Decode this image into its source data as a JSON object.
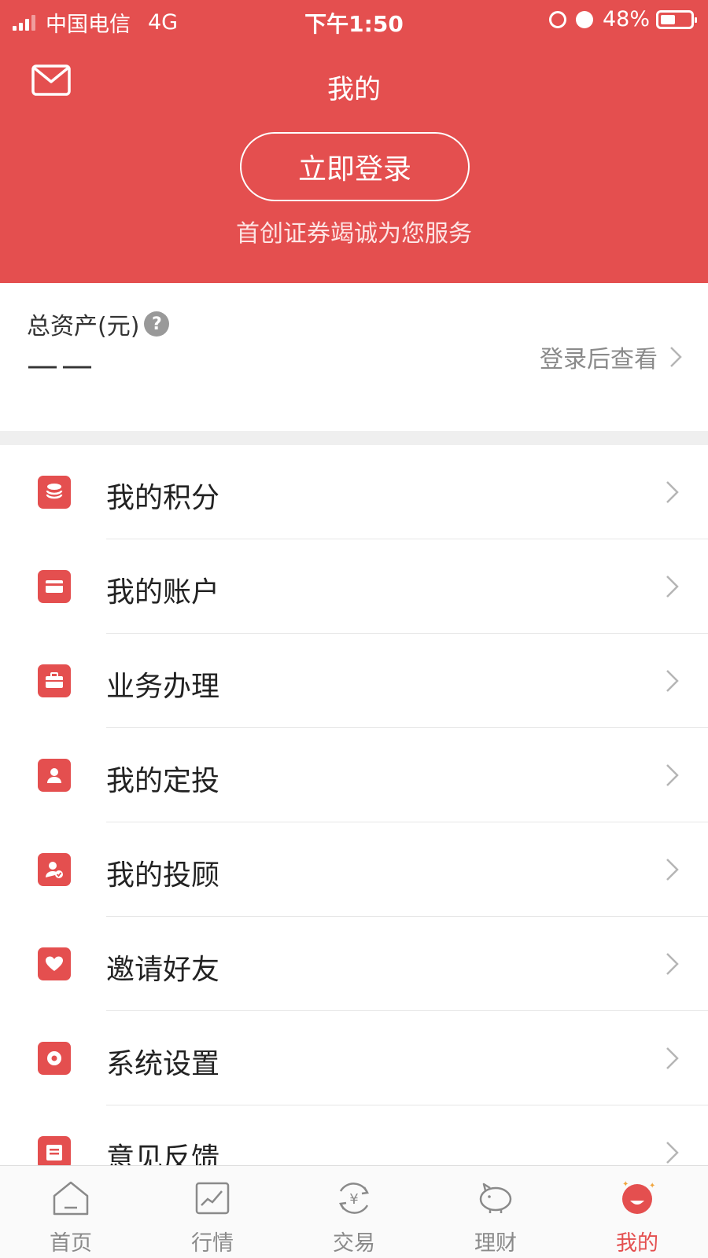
{
  "status_bar": {
    "carrier": "中国电信",
    "network": "4G",
    "time": "下午1:50",
    "battery": "48%"
  },
  "header": {
    "title": "我的",
    "login_button": "立即登录",
    "slogan": "首创证券竭诚为您服务",
    "mail_icon": "mail-icon"
  },
  "assets": {
    "label": "总资产(元)",
    "help_icon": "?",
    "value": "——",
    "link": "登录后查看"
  },
  "menu": [
    {
      "label": "我的积分",
      "icon": "coins-icon"
    },
    {
      "label": "我的账户",
      "icon": "card-icon"
    },
    {
      "label": "业务办理",
      "icon": "briefcase-icon"
    },
    {
      "label": "我的定投",
      "icon": "person-icon"
    },
    {
      "label": "我的投顾",
      "icon": "advisor-icon"
    },
    {
      "label": "邀请好友",
      "icon": "heart-icon"
    },
    {
      "label": "系统设置",
      "icon": "settings-icon"
    },
    {
      "label": "意见反馈",
      "icon": "feedback-icon"
    }
  ],
  "tabbar": [
    {
      "label": "首页",
      "icon": "home-icon"
    },
    {
      "label": "行情",
      "icon": "chart-icon"
    },
    {
      "label": "交易",
      "icon": "yen-icon"
    },
    {
      "label": "理财",
      "icon": "piggy-bank-icon"
    },
    {
      "label": "我的",
      "icon": "profile-icon",
      "active": true
    }
  ],
  "colors": {
    "brand_red": "#e44f4f",
    "text_gray": "#8a8a8a"
  }
}
